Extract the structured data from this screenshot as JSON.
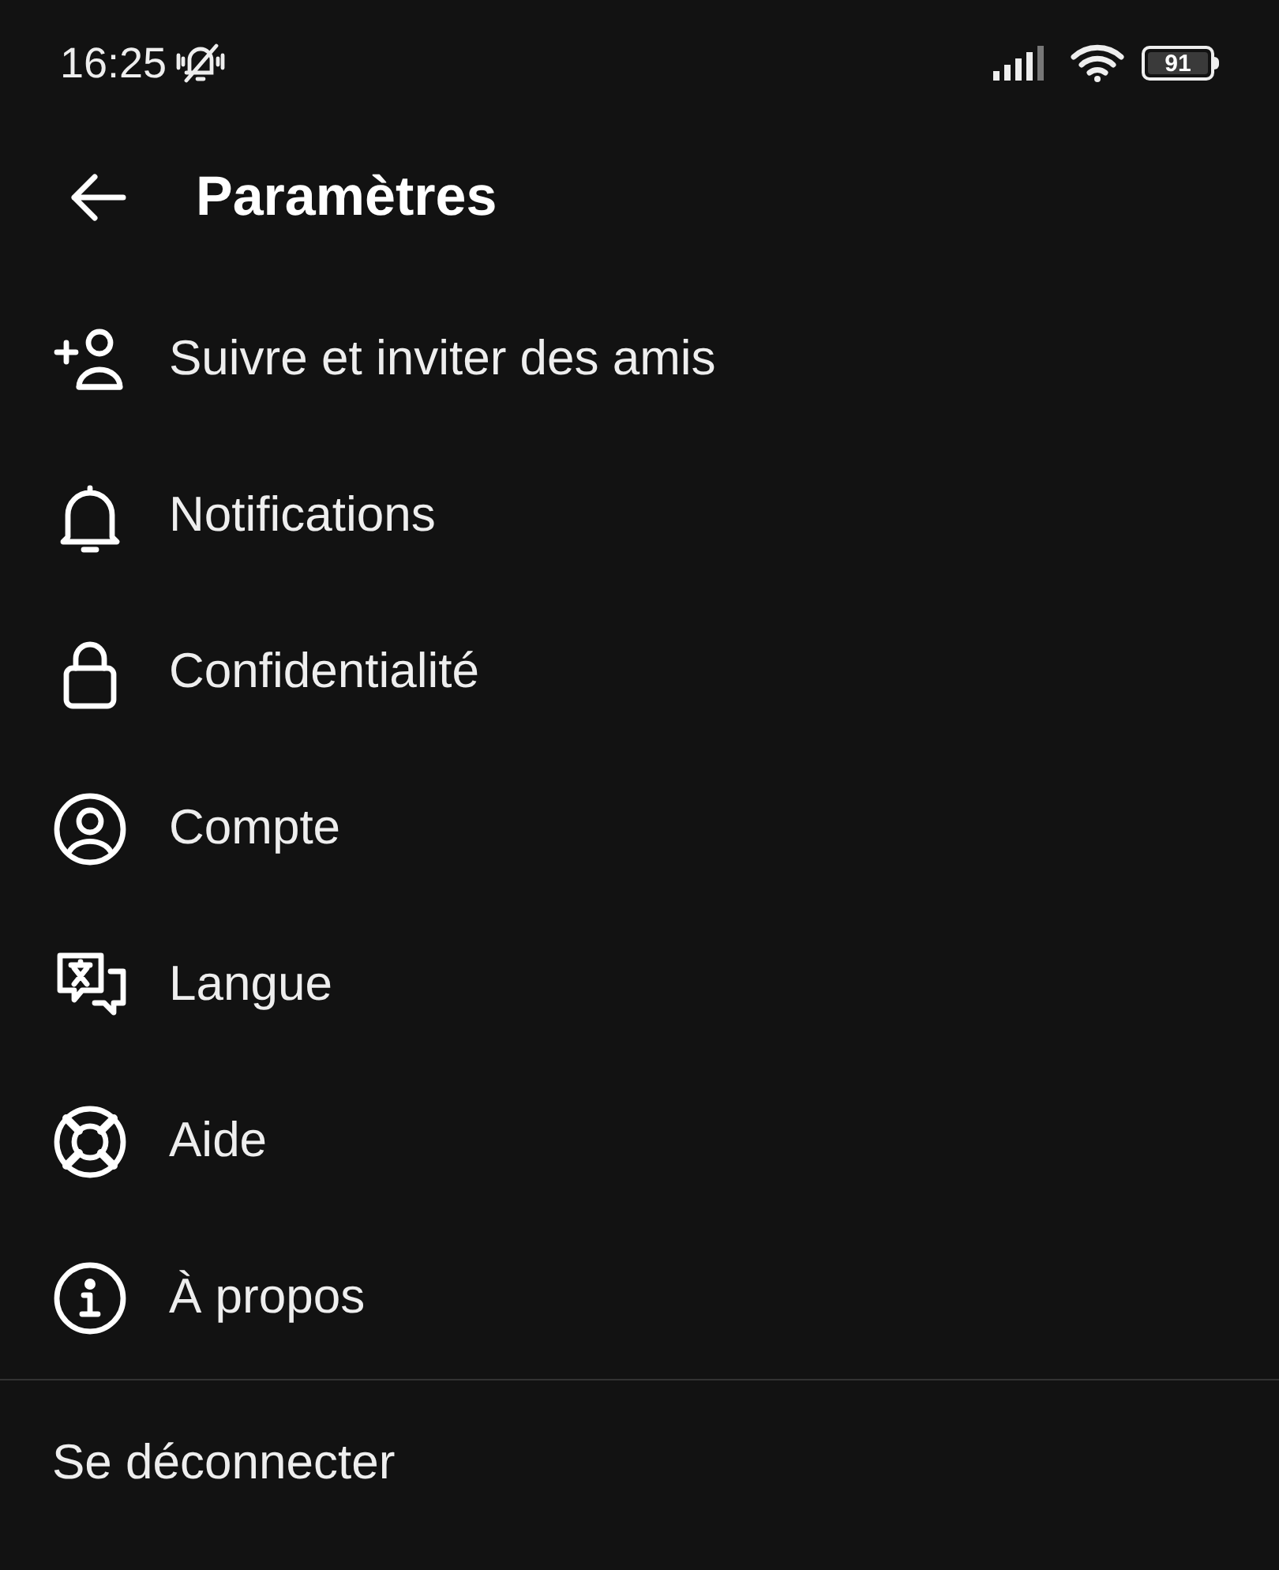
{
  "status_bar": {
    "time": "16:25",
    "battery": "91"
  },
  "header": {
    "title": "Paramètres"
  },
  "menu": [
    {
      "kind": "add-person",
      "label": "Suivre et inviter des amis"
    },
    {
      "kind": "bell",
      "label": "Notifications"
    },
    {
      "kind": "lock",
      "label": "Confidentialité"
    },
    {
      "kind": "account",
      "label": "Compte"
    },
    {
      "kind": "language",
      "label": "Langue"
    },
    {
      "kind": "help",
      "label": "Aide"
    },
    {
      "kind": "info",
      "label": "À propos"
    }
  ],
  "logout": "Se déconnecter"
}
